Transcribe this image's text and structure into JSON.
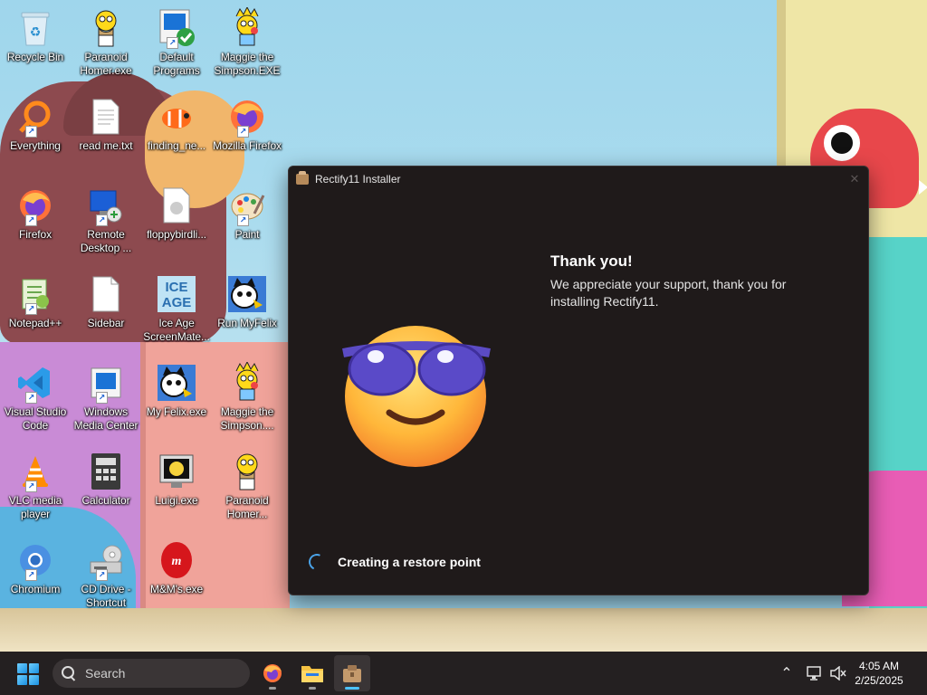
{
  "desktop": {
    "icons": [
      {
        "label": "Recycle Bin",
        "icon": "recycle-bin-icon"
      },
      {
        "label": "Paranoid Homer.exe",
        "icon": "homer-icon"
      },
      {
        "label": "Default Programs",
        "icon": "default-programs-icon"
      },
      {
        "label": "Maggie the Simpson.EXE",
        "icon": "maggie-icon"
      },
      {
        "label": "Everything",
        "icon": "everything-search-icon"
      },
      {
        "label": "read me.txt",
        "icon": "text-file-icon"
      },
      {
        "label": "finding_ne...",
        "icon": "nemo-icon"
      },
      {
        "label": "Mozilla Firefox",
        "icon": "firefox-icon"
      },
      {
        "label": "Firefox",
        "icon": "firefox-icon"
      },
      {
        "label": "Remote Desktop ...",
        "icon": "remote-desktop-icon"
      },
      {
        "label": "floppybirdli...",
        "icon": "file-icon"
      },
      {
        "label": "Paint",
        "icon": "paint-icon"
      },
      {
        "label": "Notepad++",
        "icon": "notepadpp-icon"
      },
      {
        "label": "Sidebar",
        "icon": "blank-file-icon"
      },
      {
        "label": "Ice Age ScreenMate...",
        "icon": "ice-age-icon"
      },
      {
        "label": "Run MyFelix",
        "icon": "felix-icon"
      },
      {
        "label": "Visual Studio Code",
        "icon": "vscode-icon"
      },
      {
        "label": "Windows Media Center",
        "icon": "media-center-icon"
      },
      {
        "label": "My Felix.exe",
        "icon": "felix-icon"
      },
      {
        "label": "Maggie the Simpson....",
        "icon": "maggie-icon"
      },
      {
        "label": "VLC media player",
        "icon": "vlc-icon"
      },
      {
        "label": "Calculator",
        "icon": "calculator-icon"
      },
      {
        "label": "Luigi.exe",
        "icon": "luigi-icon"
      },
      {
        "label": "Paranoid Homer...",
        "icon": "homer-icon"
      },
      {
        "label": "Chromium",
        "icon": "chromium-icon"
      },
      {
        "label": "CD Drive - Shortcut",
        "icon": "cd-drive-icon"
      },
      {
        "label": "M&M's.exe",
        "icon": "mms-icon"
      }
    ]
  },
  "installer": {
    "title": "Rectify11 Installer",
    "close_glyph": "✕",
    "heading": "Thank you!",
    "message": "We appreciate your support, thank you for installing Rectify11.",
    "status": "Creating a restore point"
  },
  "taskbar": {
    "search_placeholder": "Search",
    "apps": [
      {
        "name": "Firefox",
        "icon": "firefox-icon"
      },
      {
        "name": "File Explorer",
        "icon": "folder-icon"
      },
      {
        "name": "Rectify11 Installer",
        "icon": "installer-icon",
        "active": true
      }
    ],
    "chevron_glyph": "⌃",
    "time": "4:05 AM",
    "date": "2/25/2025"
  },
  "colors": {
    "accent": "#4cc2ff",
    "window_bg": "#1f1a1a",
    "taskbar_bg": "#242021"
  }
}
